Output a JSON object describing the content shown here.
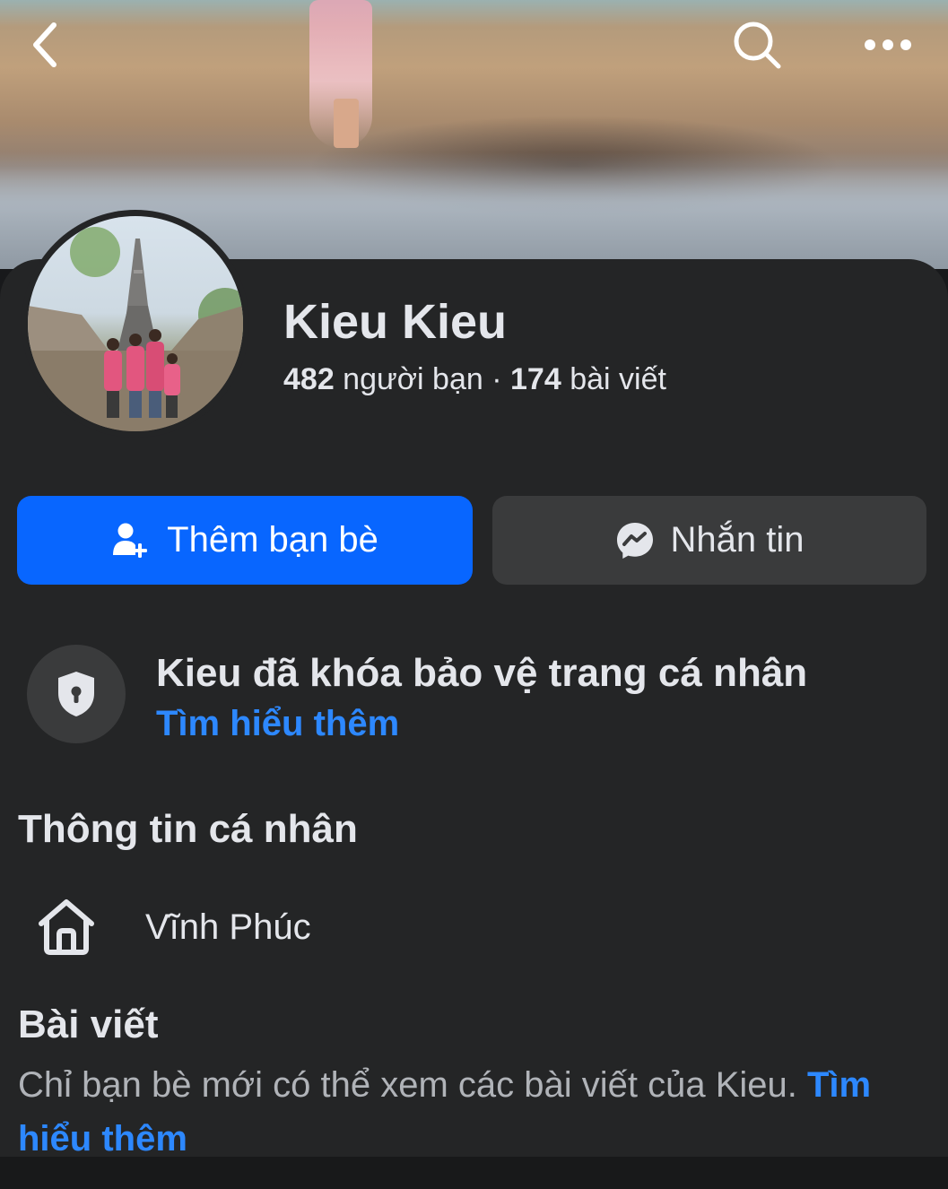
{
  "header": {
    "back_icon": "chevron-left-icon",
    "search_icon": "search-icon",
    "more_icon": "more-horizontal-icon"
  },
  "profile": {
    "name": "Kieu Kieu",
    "friends_count": "482",
    "friends_label": " người bạn",
    "separator": " · ",
    "posts_count": "174",
    "posts_label": " bài viết"
  },
  "actions": {
    "add_friend_label": "Thêm bạn bè",
    "add_friend_icon": "person-add-icon",
    "message_label": "Nhắn tin",
    "message_icon": "messenger-icon"
  },
  "lock_notice": {
    "icon": "shield-lock-icon",
    "title": "Kieu đã khóa bảo vệ trang cá nhân",
    "link": "Tìm hiểu thêm"
  },
  "personal_info": {
    "title": "Thông tin cá nhân",
    "hometown_icon": "home-icon",
    "hometown": "Vĩnh Phúc"
  },
  "posts": {
    "title": "Bài viết",
    "note": "Chỉ bạn bè mới có thể xem các bài viết của Kieu. ",
    "link": "Tìm hiểu thêm"
  },
  "colors": {
    "accent_blue": "#0866ff",
    "link_blue": "#2d88ff",
    "sheet_bg": "#242526",
    "secondary_button": "#3a3b3c"
  }
}
